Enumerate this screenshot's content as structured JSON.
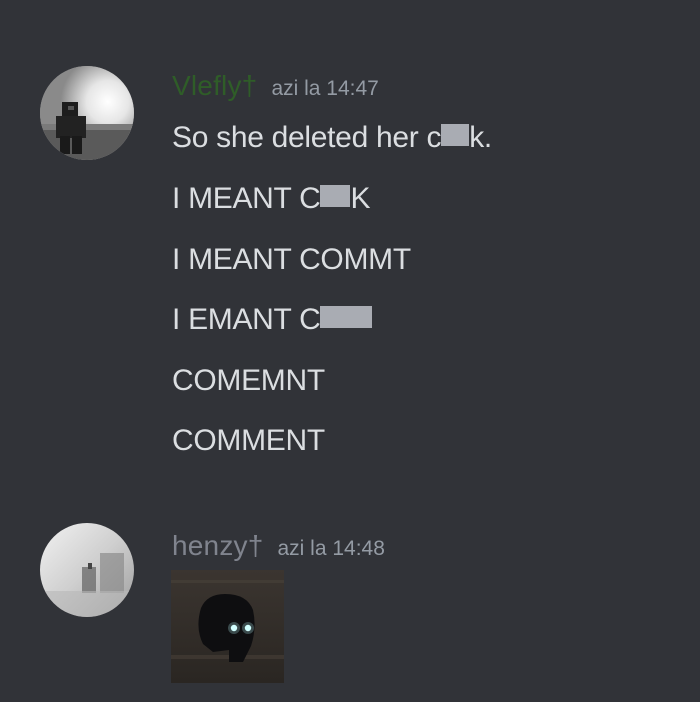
{
  "messages": [
    {
      "author": "Vlefly†",
      "author_color": "#2f5d28",
      "timestamp": "azi la 14:47",
      "lines": [
        {
          "before": "So she deleted her c",
          "after": "k."
        },
        {
          "before": "I MEANT C",
          "after": "K"
        },
        {
          "before": "I MEANT COMMT",
          "after": ""
        },
        {
          "before": "I EMANT C",
          "after": ""
        },
        {
          "before": "COMEMNT",
          "after": ""
        },
        {
          "before": "COMMENT",
          "after": ""
        }
      ]
    },
    {
      "author": "henzy†",
      "author_color": "#80848e",
      "timestamp": "azi la 14:48",
      "attachment": "image-attachment"
    }
  ]
}
